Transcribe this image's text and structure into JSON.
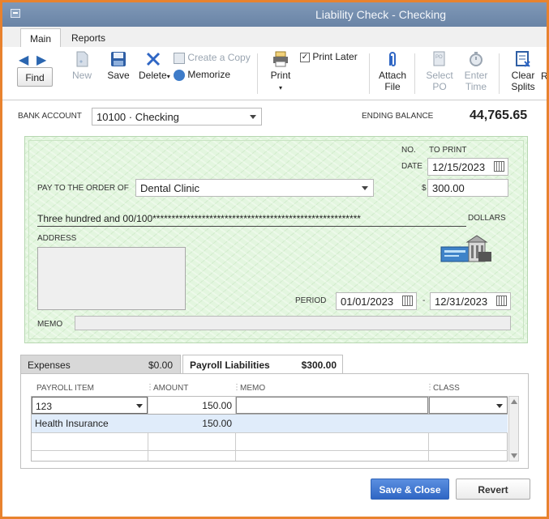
{
  "window": {
    "title": "Liability Check - Checking"
  },
  "ribbon_tabs": [
    "Main",
    "Reports"
  ],
  "toolbar": {
    "find": "Find",
    "new": "New",
    "save": "Save",
    "delete": "Delete",
    "create_copy": "Create a Copy",
    "memorize": "Memorize",
    "print": "Print",
    "print_later": "Print Later",
    "print_later_checked": true,
    "attach_file_1": "Attach",
    "attach_file_2": "File",
    "select_po_1": "Select",
    "select_po_2": "PO",
    "enter_time_1": "Enter",
    "enter_time_2": "Time",
    "clear_splits_1": "Clear",
    "clear_splits_2": "Splits",
    "overflow": "R"
  },
  "header": {
    "bank_account_label": "BANK ACCOUNT",
    "bank_account": "10100 · Checking",
    "ending_balance_label": "ENDING BALANCE",
    "ending_balance": "44,765.65"
  },
  "check": {
    "no_label": "NO.",
    "no_value": "TO PRINT",
    "date_label": "DATE",
    "date": "12/15/2023",
    "pay_to_label": "PAY TO THE ORDER OF",
    "payee": "Dental Clinic",
    "dollar_sign": "$",
    "amount": "300.00",
    "amount_words": "Three hundred and 00/100*******************************************************",
    "dollars_label": "DOLLARS",
    "address_label": "ADDRESS",
    "period_label": "PERIOD",
    "period_from": "01/01/2023",
    "period_dash": "-",
    "period_to": "12/31/2023",
    "memo_label": "MEMO",
    "memo": ""
  },
  "details": {
    "expenses_tab": "Expenses",
    "expenses_amount": "$0.00",
    "payroll_tab": "Payroll Liabilities",
    "payroll_amount": "$300.00",
    "columns": [
      "PAYROLL ITEM",
      "AMOUNT",
      "MEMO",
      "CLASS"
    ],
    "rows": [
      {
        "item": "123",
        "amount": "150.00",
        "memo": "",
        "class": ""
      },
      {
        "item": "Health Insurance",
        "amount": "150.00",
        "memo": "",
        "class": ""
      }
    ]
  },
  "footer": {
    "save_close": "Save & Close",
    "revert": "Revert"
  },
  "colors": {
    "accent": "#2f66c4",
    "check_bg": "#e3f6df",
    "frame": "#e8822e"
  }
}
